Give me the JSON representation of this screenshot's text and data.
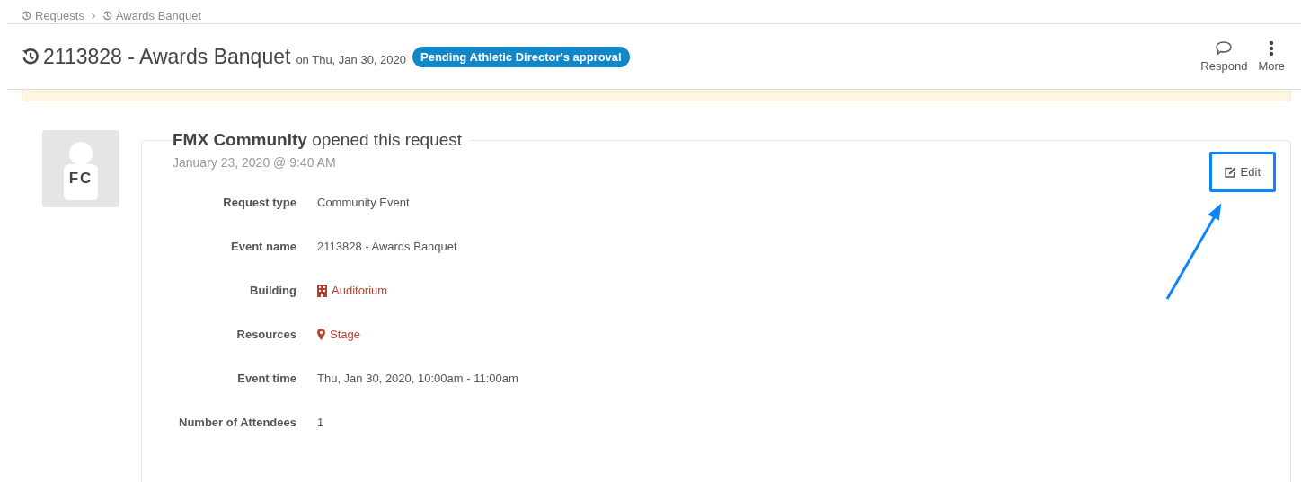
{
  "breadcrumbs": [
    {
      "label": "Requests"
    },
    {
      "label": "Awards Banquet"
    }
  ],
  "header": {
    "title": "2113828 - Awards Banquet",
    "date": "on Thu, Jan 30, 2020",
    "status": "Pending Athletic Director's approval",
    "actions": [
      {
        "kind": "respond",
        "label": "Respond"
      },
      {
        "kind": "more",
        "label": "More"
      }
    ]
  },
  "activity": {
    "avatar": "FC",
    "title": "**FMX Community** opened this request",
    "timestamp": "January 23, 2020 @ 9:40 AM",
    "edit_button": "Edit",
    "fields": [
      {
        "label": "Request type",
        "value": "Community Event",
        "kind": "plain"
      },
      {
        "label": "Event name",
        "value": "2113828 - Awards Banquet",
        "kind": "plain"
      },
      {
        "label": "Building",
        "value": "Auditorium",
        "kind": "building"
      },
      {
        "label": "Resources",
        "value": "Stage",
        "kind": "location"
      },
      {
        "label": "Event time",
        "value": "Thu, Jan 30, 2020, 10:00am - 11:00am",
        "kind": "plain"
      },
      {
        "label": "Number of Attendees",
        "value": "1",
        "kind": "plain"
      }
    ]
  }
}
